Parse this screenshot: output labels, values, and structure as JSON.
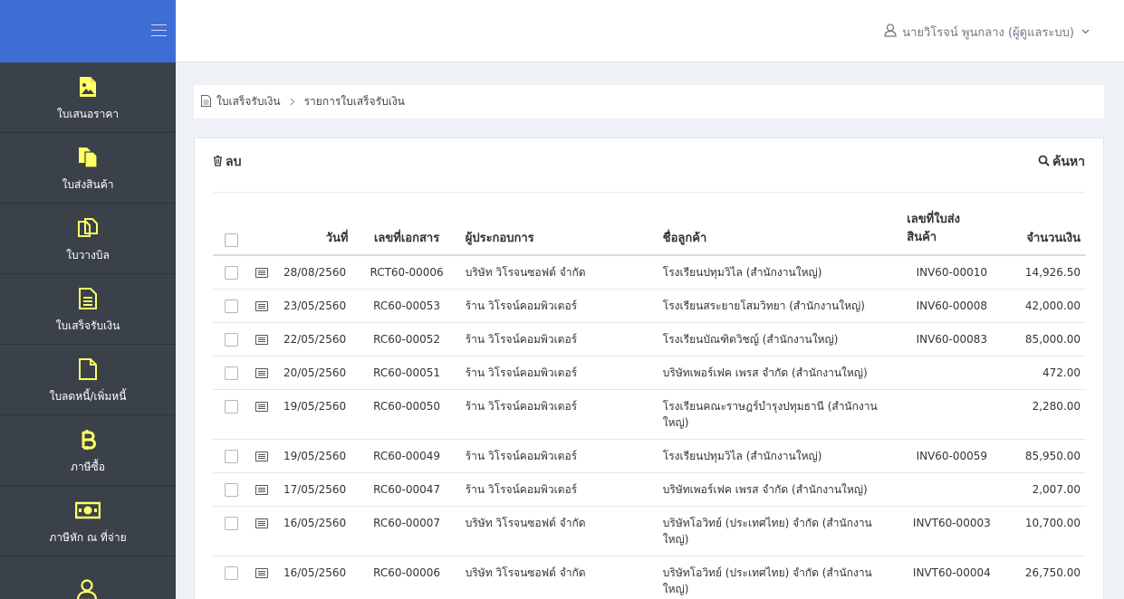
{
  "user": {
    "name": "นายวิโรจน์ พูนกลาง (ผู้ดูแลระบบ)"
  },
  "sidebar": {
    "items": [
      {
        "label": "ใบเสนอราคา",
        "icon": "image-file-icon"
      },
      {
        "label": "ใบส่งสินค้า",
        "icon": "copy-files-icon"
      },
      {
        "label": "ใบวางบิล",
        "icon": "clone-icon"
      },
      {
        "label": "ใบเสร็จรับเงิน",
        "icon": "file-text-icon"
      },
      {
        "label": "ใบลดหนี้/เพิ่มหนี้",
        "icon": "file-icon"
      },
      {
        "label": "ภาษีซื้อ",
        "icon": "bitcoin-icon"
      },
      {
        "label": "ภาษีหัก ณ ที่จ่าย",
        "icon": "money-icon"
      },
      {
        "label": "",
        "icon": "users-icon"
      }
    ],
    "accent_color": "#ffff66"
  },
  "breadcrumb": {
    "root": "ใบเสร็จรับเงิน",
    "current": "รายการใบเสร็จรับเงิน"
  },
  "toolbar": {
    "delete_label": "ลบ",
    "search_label": "ค้นหา"
  },
  "table": {
    "headers": {
      "date": "วันที่",
      "doc_no": "เลขที่เอกสาร",
      "vendor": "ผู้ประกอบการ",
      "customer": "ชื่อลูกค้า",
      "invoice_line1": "เลขที่ใบส่ง",
      "invoice_line2": "สินค้า",
      "amount": "จำนวนเงิน"
    },
    "rows": [
      {
        "date": "28/08/2560",
        "doc_no": "RCT60-00006",
        "vendor": "บริษัท วิโรจนซอฟต์ จำกัด",
        "customer": "โรงเรียนปทุมวิไล (สำนักงานใหญ่)",
        "invoice": "INV60-00010",
        "amount": "14,926.50"
      },
      {
        "date": "23/05/2560",
        "doc_no": "RC60-00053",
        "vendor": "ร้าน วิโรจน์คอมพิวเตอร์",
        "customer": "โรงเรียนสระยายโสมวิทยา (สำนักงานใหญ่)",
        "invoice": "INV60-00008",
        "amount": "42,000.00"
      },
      {
        "date": "22/05/2560",
        "doc_no": "RC60-00052",
        "vendor": "ร้าน วิโรจน์คอมพิวเตอร์",
        "customer": "โรงเรียนบัณฑิตวิชญ์ (สำนักงานใหญ่)",
        "invoice": "INV60-00083",
        "amount": "85,000.00"
      },
      {
        "date": "20/05/2560",
        "doc_no": "RC60-00051",
        "vendor": "ร้าน วิโรจน์คอมพิวเตอร์",
        "customer": "บริษัทเพอร์เฟค เพรส จำกัด (สำนักงานใหญ่)",
        "invoice": "",
        "amount": "472.00"
      },
      {
        "date": "19/05/2560",
        "doc_no": "RC60-00050",
        "vendor": "ร้าน วิโรจน์คอมพิวเตอร์",
        "customer": "โรงเรียนคณะราษฎร์บำรุงปทุมธานี (สำนักงานใหญ่)",
        "invoice": "",
        "amount": "2,280.00"
      },
      {
        "date": "19/05/2560",
        "doc_no": "RC60-00049",
        "vendor": "ร้าน วิโรจน์คอมพิวเตอร์",
        "customer": "โรงเรียนปทุมวิไล (สำนักงานใหญ่)",
        "invoice": "INV60-00059",
        "amount": "85,950.00"
      },
      {
        "date": "17/05/2560",
        "doc_no": "RC60-00047",
        "vendor": "ร้าน วิโรจน์คอมพิวเตอร์",
        "customer": "บริษัทเพอร์เฟค เพรส จำกัด (สำนักงานใหญ่)",
        "invoice": "",
        "amount": "2,007.00"
      },
      {
        "date": "16/05/2560",
        "doc_no": "RC60-00007",
        "vendor": "บริษัท วิโรจนซอฟต์ จำกัด",
        "customer": "บริษัทโอวิทย์ (ประเทศไทย) จำกัด (สำนักงานใหญ่)",
        "invoice": "INVT60-00003",
        "amount": "10,700.00"
      },
      {
        "date": "16/05/2560",
        "doc_no": "RC60-00006",
        "vendor": "บริษัท วิโรจนซอฟต์ จำกัด",
        "customer": "บริษัทโอวิทย์ (ประเทศไทย) จำกัด (สำนักงานใหญ่)",
        "invoice": "INVT60-00004",
        "amount": "26,750.00"
      }
    ]
  }
}
